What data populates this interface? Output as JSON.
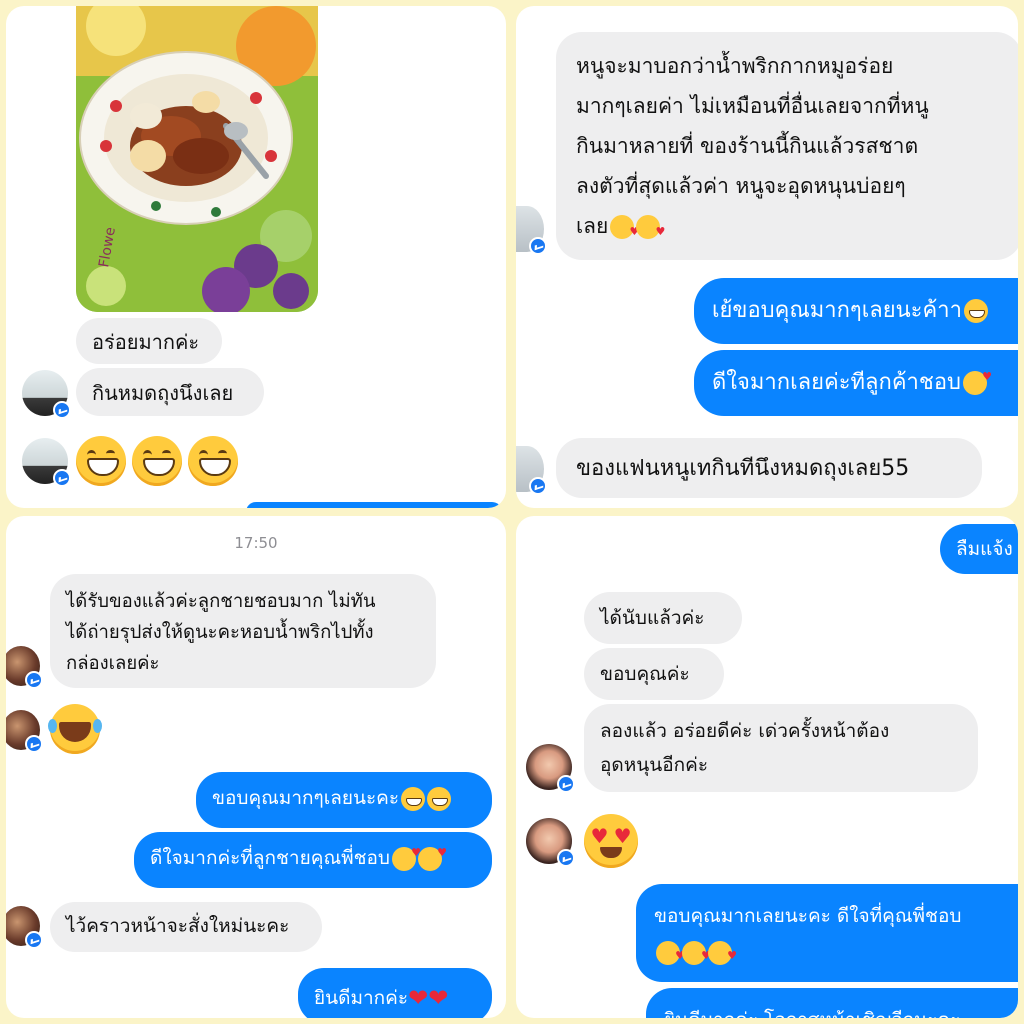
{
  "panel1": {
    "messages": [
      "อร่อยมากค่ะ",
      "กินหมดถุงนึงเลย"
    ],
    "photo_label": "Flowe"
  },
  "panel2": {
    "incoming_long": [
      "หนูจะมาบอกว่าน้ำพริกกากหมูอร่อย",
      "มากๆเลยค่า ไม่เหมือนที่อื่นเลยจากที่หนู",
      "กินมาหลายที่ ของร้านนี้กินแล้วรสชาต",
      "ลงตัวที่สุดแล้วค่า หนูจะอุดหนุนบ่อยๆ",
      "เลย"
    ],
    "outgoing": [
      "เย้ขอบคุณมากๆเลยนะค้าา",
      "ดีใจมากเลยค่ะทีลูกค้าชอบ"
    ],
    "incoming_last": "ของแฟนหนูเทกินทีนึงหมดถุงเลย55"
  },
  "panel3": {
    "timestamp": "17:50",
    "incoming_long": [
      "ได้รับของแล้วค่ะลูกชายชอบมาก ไม่ทัน",
      "ได้ถ่ายรุปส่งให้ดูนะคะหอบน้ำพริกไปทั้ง",
      "กล่องเลยค่ะ"
    ],
    "outgoing": [
      "ขอบคุณมากๆเลยนะคะ",
      "ดีใจมากค่ะที่ลูกชายคุณพี่ชอบ"
    ],
    "incoming_last": "ไว้คราวหน้าจะสั่งใหม่นะคะ",
    "outgoing_last": "ยินดีมากค่ะ"
  },
  "panel4": {
    "outgoing_top": "ลืมแจ้ง",
    "incoming": [
      "ได้นับแล้วค่ะ",
      "ขอบคุณค่ะ"
    ],
    "incoming_long": [
      "ลองแล้ว  อร่อยดีค่ะ  เด่วครั้งหน้าต้อง",
      "อุดหนุนอีกค่ะ"
    ],
    "outgoing_long": "ขอบคุณมากเลยนะคะ ดีใจที่คุณพี่ชอบ",
    "outgoing_cut": "ยินดีมากค่ะ โอกาสหน้าเชิญอีกนะคะ"
  },
  "colors": {
    "outgoing_bubble": "#0a84ff",
    "incoming_bubble": "#eeeeef",
    "background": "#fbf4c8"
  },
  "icons": [
    "messenger-badge-icon",
    "grinning-emoji-icon",
    "tears-of-joy-emoji-icon",
    "heart-eyes-emoji-icon",
    "smiling-hearts-emoji-icon",
    "red-heart-icon"
  ]
}
